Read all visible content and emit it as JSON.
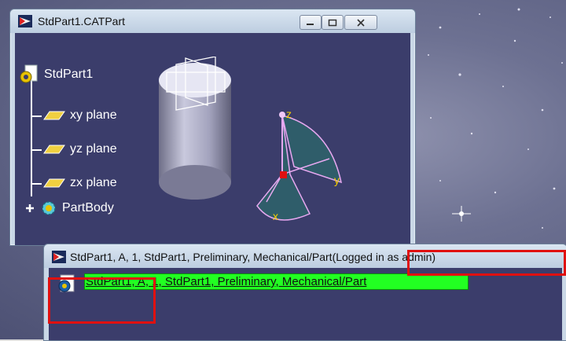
{
  "window1": {
    "title": "StdPart1.CATPart",
    "tree": {
      "root": "StdPart1",
      "items": [
        {
          "label": "xy plane"
        },
        {
          "label": "yz plane"
        },
        {
          "label": "zx plane"
        },
        {
          "label": "PartBody"
        }
      ]
    },
    "axis_labels": {
      "z": "z",
      "y": "y",
      "x": "x"
    }
  },
  "window2": {
    "title": "StdPart1, A, 1, StdPart1, Preliminary, Mechanical/Part",
    "login_status": "(Logged in as admin)",
    "node_label": "StdPart1, A, 1, StdPart1, Preliminary, Mechanical/Part"
  },
  "colors": {
    "viewport_bg": "#3b3d6b",
    "highlight": "#22ff22",
    "annotation_red": "#e01010"
  }
}
